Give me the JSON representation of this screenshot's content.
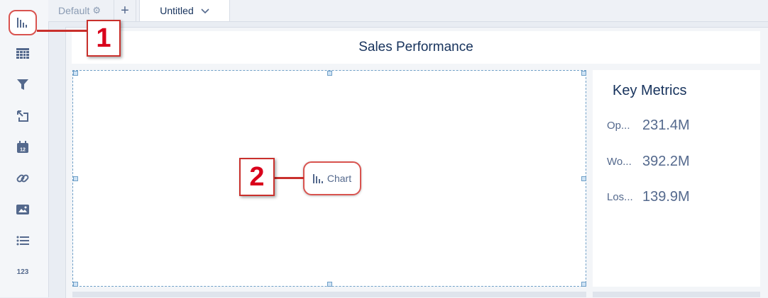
{
  "sidebar": {
    "tools": [
      {
        "icon": "bar-chart-icon"
      },
      {
        "icon": "table-icon"
      },
      {
        "icon": "filter-icon"
      },
      {
        "icon": "toggle-arrow-icon"
      },
      {
        "icon": "calendar-icon",
        "text": "12"
      },
      {
        "icon": "link-icon"
      },
      {
        "icon": "image-icon"
      },
      {
        "icon": "list-icon"
      },
      {
        "icon": "number-icon",
        "text": "123"
      }
    ]
  },
  "tabs": {
    "default_label": "Default",
    "add_label": "+",
    "active_label": "Untitled"
  },
  "dashboard": {
    "title": "Sales Performance",
    "chart_placeholder": "Chart",
    "metrics": {
      "title": "Key Metrics",
      "items": [
        {
          "label": "Op...",
          "value": "231.4M"
        },
        {
          "label": "Wo...",
          "value": "392.2M"
        },
        {
          "label": "Los...",
          "value": "139.9M"
        }
      ]
    }
  },
  "callouts": [
    "1",
    "2"
  ],
  "colors": {
    "accent": "#d9001b",
    "callout_border": "#c9302c",
    "selection": "#6f9fc7",
    "text": "#16325c",
    "muted": "#54698d"
  }
}
